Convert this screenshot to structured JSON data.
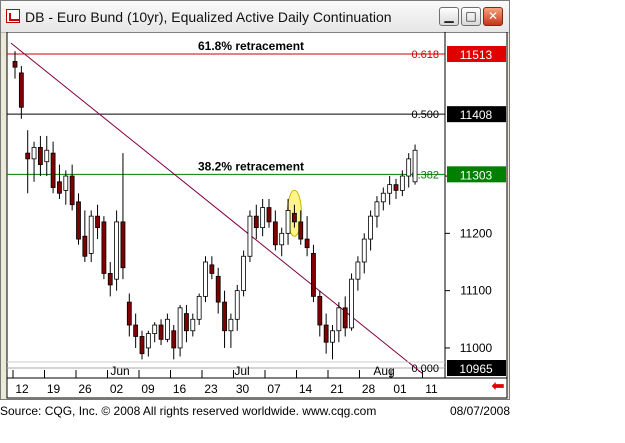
{
  "window": {
    "title": "DB - Euro Bund (10yr), Equalized Active Daily Continuation",
    "minimize_glyph": "▁",
    "maximize_glyph": "□",
    "close_glyph": "✕"
  },
  "chart_data": {
    "type": "candlestick",
    "title": "DB - Euro Bund (10yr), Equalized Active Daily Continuation",
    "y_ticks": [
      11300,
      11200,
      11100,
      11000
    ],
    "x_ticks": [
      "12",
      "19",
      "26",
      "02",
      "09",
      "16",
      "23",
      "30",
      "07",
      "14",
      "21",
      "28",
      "01",
      "11"
    ],
    "month_labels": [
      "Jun",
      "Jul",
      "Aug"
    ],
    "ylim": [
      10965,
      11513
    ],
    "grid": false,
    "levels": [
      {
        "ratio": "0.618",
        "price": "11513",
        "line_color": "#cc0000",
        "badge_color": "#e00000",
        "label": "61.8% retracement"
      },
      {
        "ratio": "0.500",
        "price": "11408",
        "line_color": "#000000",
        "badge_color": "#000000",
        "label": ""
      },
      {
        "ratio": "0.382",
        "price": "11303",
        "line_color": "#008000",
        "badge_color": "#008000",
        "label": "38.2% retracement"
      },
      {
        "ratio": "0.000",
        "price": "10965",
        "line_color": "#aaaaaa",
        "badge_color": "#000000",
        "label": ""
      }
    ],
    "trendline": {
      "color": "#800040"
    },
    "highlight": {
      "color": "#fff58a"
    },
    "candles": [
      {
        "o": 11500,
        "h": 11518,
        "l": 11470,
        "c": 11490
      },
      {
        "o": 11480,
        "h": 11492,
        "l": 11400,
        "c": 11420
      },
      {
        "o": 11340,
        "h": 11380,
        "l": 11270,
        "c": 11330
      },
      {
        "o": 11330,
        "h": 11360,
        "l": 11290,
        "c": 11350
      },
      {
        "o": 11350,
        "h": 11370,
        "l": 11300,
        "c": 11320
      },
      {
        "o": 11325,
        "h": 11370,
        "l": 11300,
        "c": 11345
      },
      {
        "o": 11340,
        "h": 11360,
        "l": 11270,
        "c": 11280
      },
      {
        "o": 11290,
        "h": 11320,
        "l": 11260,
        "c": 11270
      },
      {
        "o": 11275,
        "h": 11310,
        "l": 11250,
        "c": 11300
      },
      {
        "o": 11300,
        "h": 11320,
        "l": 11240,
        "c": 11250
      },
      {
        "o": 11255,
        "h": 11270,
        "l": 11180,
        "c": 11190
      },
      {
        "o": 11195,
        "h": 11240,
        "l": 11150,
        "c": 11160
      },
      {
        "o": 11165,
        "h": 11240,
        "l": 11150,
        "c": 11230
      },
      {
        "o": 11230,
        "h": 11250,
        "l": 11190,
        "c": 11210
      },
      {
        "o": 11220,
        "h": 11230,
        "l": 11120,
        "c": 11130
      },
      {
        "o": 11130,
        "h": 11150,
        "l": 11090,
        "c": 11110
      },
      {
        "o": 11120,
        "h": 11240,
        "l": 11100,
        "c": 11220
      },
      {
        "o": 11220,
        "h": 11340,
        "l": 11120,
        "c": 11140
      },
      {
        "o": 11080,
        "h": 11095,
        "l": 11020,
        "c": 11040
      },
      {
        "o": 11040,
        "h": 11060,
        "l": 11000,
        "c": 11020
      },
      {
        "o": 11020,
        "h": 11030,
        "l": 10980,
        "c": 10990
      },
      {
        "o": 11000,
        "h": 11030,
        "l": 10985,
        "c": 11025
      },
      {
        "o": 11025,
        "h": 11045,
        "l": 11010,
        "c": 11040
      },
      {
        "o": 11040,
        "h": 11050,
        "l": 11005,
        "c": 11015
      },
      {
        "o": 11015,
        "h": 11060,
        "l": 11010,
        "c": 11050
      },
      {
        "o": 11030,
        "h": 11040,
        "l": 10980,
        "c": 11000
      },
      {
        "o": 11000,
        "h": 11075,
        "l": 10985,
        "c": 11070
      },
      {
        "o": 11060,
        "h": 11075,
        "l": 11010,
        "c": 11030
      },
      {
        "o": 11030,
        "h": 11060,
        "l": 11020,
        "c": 11050
      },
      {
        "o": 11050,
        "h": 11095,
        "l": 11040,
        "c": 11090
      },
      {
        "o": 11090,
        "h": 11160,
        "l": 11080,
        "c": 11150
      },
      {
        "o": 11145,
        "h": 11160,
        "l": 11120,
        "c": 11130
      },
      {
        "o": 11125,
        "h": 11140,
        "l": 11060,
        "c": 11080
      },
      {
        "o": 11080,
        "h": 11100,
        "l": 11000,
        "c": 11030
      },
      {
        "o": 11030,
        "h": 11060,
        "l": 11000,
        "c": 11050
      },
      {
        "o": 11050,
        "h": 11110,
        "l": 11030,
        "c": 11100
      },
      {
        "o": 11100,
        "h": 11170,
        "l": 11090,
        "c": 11160
      },
      {
        "o": 11160,
        "h": 11240,
        "l": 11150,
        "c": 11230
      },
      {
        "o": 11230,
        "h": 11250,
        "l": 11190,
        "c": 11210
      },
      {
        "o": 11210,
        "h": 11260,
        "l": 11195,
        "c": 11245
      },
      {
        "o": 11245,
        "h": 11260,
        "l": 11210,
        "c": 11220
      },
      {
        "o": 11220,
        "h": 11240,
        "l": 11170,
        "c": 11180
      },
      {
        "o": 11180,
        "h": 11210,
        "l": 11160,
        "c": 11200
      },
      {
        "o": 11200,
        "h": 11260,
        "l": 11180,
        "c": 11240
      },
      {
        "o": 11235,
        "h": 11250,
        "l": 11210,
        "c": 11220
      },
      {
        "o": 11220,
        "h": 11240,
        "l": 11180,
        "c": 11190
      },
      {
        "o": 11190,
        "h": 11230,
        "l": 11160,
        "c": 11175
      },
      {
        "o": 11165,
        "h": 11180,
        "l": 11080,
        "c": 11090
      },
      {
        "o": 11090,
        "h": 11100,
        "l": 11020,
        "c": 11040
      },
      {
        "o": 11040,
        "h": 11060,
        "l": 10990,
        "c": 11010
      },
      {
        "o": 11010,
        "h": 11040,
        "l": 10980,
        "c": 11030
      },
      {
        "o": 11030,
        "h": 11080,
        "l": 11010,
        "c": 11070
      },
      {
        "o": 11070,
        "h": 11090,
        "l": 11020,
        "c": 11035
      },
      {
        "o": 11035,
        "h": 11130,
        "l": 11030,
        "c": 11120
      },
      {
        "o": 11120,
        "h": 11160,
        "l": 11100,
        "c": 11150
      },
      {
        "o": 11150,
        "h": 11200,
        "l": 11130,
        "c": 11190
      },
      {
        "o": 11190,
        "h": 11240,
        "l": 11170,
        "c": 11230
      },
      {
        "o": 11230,
        "h": 11265,
        "l": 11210,
        "c": 11255
      },
      {
        "o": 11255,
        "h": 11280,
        "l": 11240,
        "c": 11270
      },
      {
        "o": 11270,
        "h": 11300,
        "l": 11250,
        "c": 11285
      },
      {
        "o": 11285,
        "h": 11295,
        "l": 11260,
        "c": 11275
      },
      {
        "o": 11275,
        "h": 11310,
        "l": 11265,
        "c": 11300
      },
      {
        "o": 11300,
        "h": 11340,
        "l": 11280,
        "c": 11330
      },
      {
        "o": 11290,
        "h": 11355,
        "l": 11285,
        "c": 11345
      }
    ]
  },
  "footer": {
    "source": "Source: CQG, Inc. © 2008 All rights reserved worldwide. www.cqg.com",
    "date": "08/07/2008"
  },
  "arrow_glyph": "⬅"
}
